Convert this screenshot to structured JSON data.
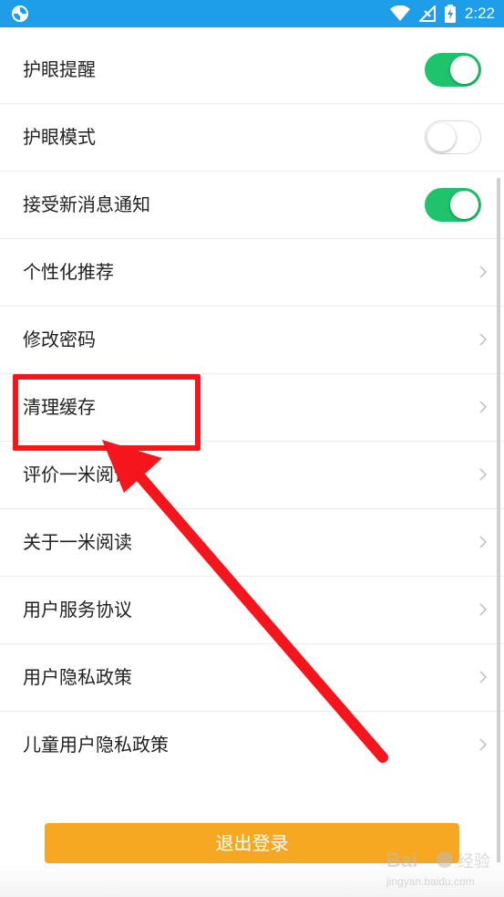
{
  "status_bar": {
    "time": "2:22",
    "color": "#1e9ee8"
  },
  "settings": [
    {
      "label": "护眼提醒",
      "control": "toggle",
      "state": "on"
    },
    {
      "label": "护眼模式",
      "control": "toggle",
      "state": "off"
    },
    {
      "label": "接受新消息通知",
      "control": "toggle",
      "state": "on"
    },
    {
      "label": "个性化推荐",
      "control": "chevron"
    },
    {
      "label": "修改密码",
      "control": "chevron"
    },
    {
      "label": "清理缓存",
      "control": "chevron"
    },
    {
      "label": "评价一米阅读",
      "control": "chevron"
    },
    {
      "label": "关于一米阅读",
      "control": "chevron"
    },
    {
      "label": "用户服务协议",
      "control": "chevron"
    },
    {
      "label": "用户隐私政策",
      "control": "chevron"
    },
    {
      "label": "儿童用户隐私政策",
      "control": "chevron"
    }
  ],
  "logout_button": {
    "label": "退出登录",
    "color": "#f7a823"
  },
  "colors": {
    "toggle_on": "#1ec36b",
    "annotation": "#f5151d"
  },
  "watermark": {
    "brand": "Bai",
    "sub": "经验",
    "domain": "jingyan.baidu.com"
  }
}
